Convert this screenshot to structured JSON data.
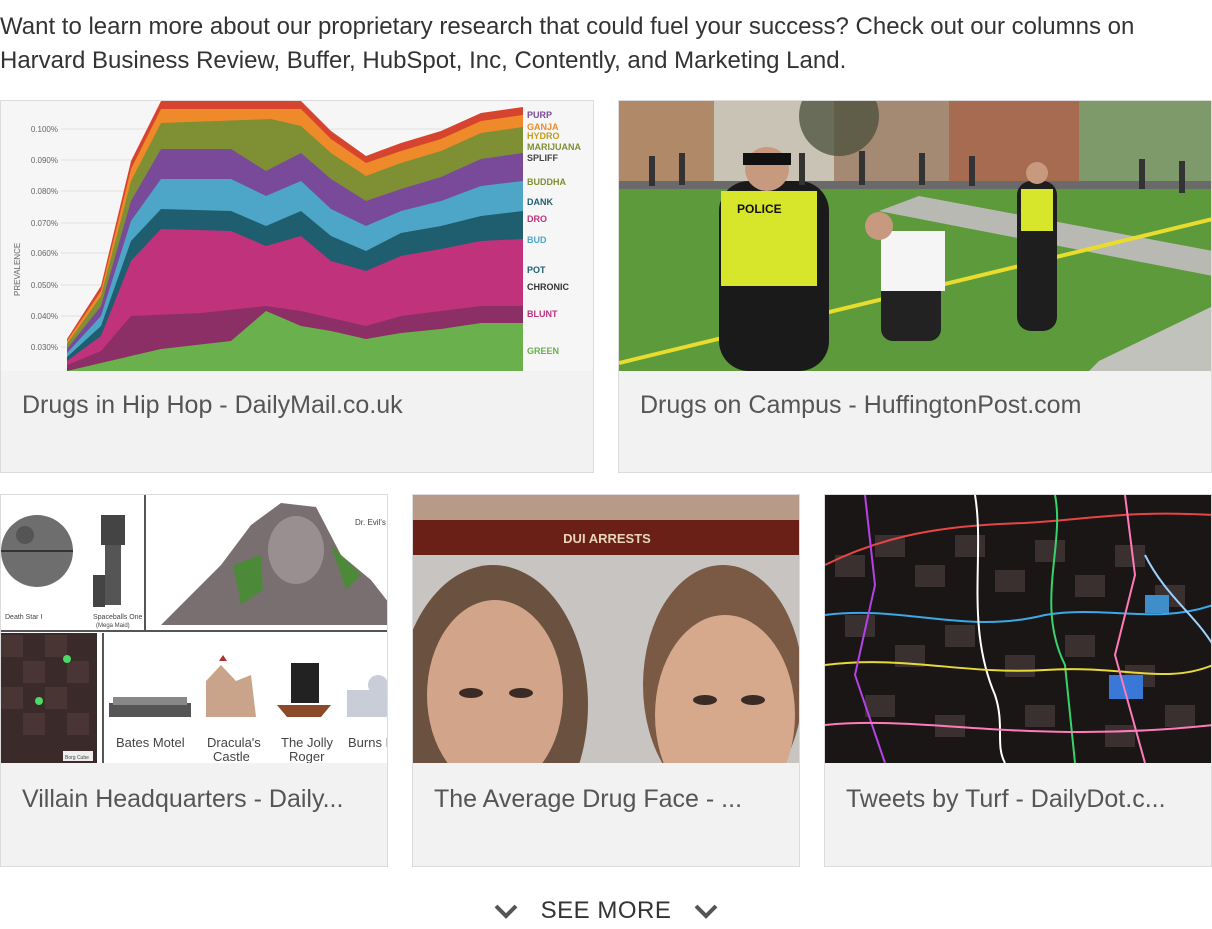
{
  "intro_text": "Want to learn more about our proprietary research that could fuel your success? Check out our columns on Harvard Business Review, Buffer, HubSpot, Inc, Contently, and Marketing Land.",
  "cards": [
    {
      "title": "Drugs in Hip Hop - DailyMail.co.uk",
      "chart": {
        "y_ticks": [
          "0.100%",
          "0.090%",
          "0.080%",
          "0.070%",
          "0.060%",
          "0.050%",
          "0.040%",
          "0.030%"
        ],
        "y_label": "PREVALENCE",
        "legend": [
          "PURP",
          "GANJA",
          "HYDRO",
          "MARIJUANA",
          "SPLIFF",
          "BUDDHA",
          "DANK",
          "DRO",
          "BUD",
          "POT",
          "CHRONIC",
          "BLUNT",
          "GREEN"
        ]
      }
    },
    {
      "title": "Drugs on Campus - HuffingtonPost.com",
      "photo_text": "POLICE"
    },
    {
      "title": "Villain Headquarters - Daily...",
      "labels": {
        "death_star": "Death Star I",
        "spaceballs": "Spaceballs One",
        "spaceballs_sub": "(Mega Maid)",
        "dr_evil": "Dr. Evil's",
        "bates": "Bates Motel",
        "dracula_1": "Dracula's",
        "dracula_2": "Castle",
        "jolly_1": "The Jolly",
        "jolly_2": "Roger",
        "burns": "Burns M",
        "borg": "Borg Cube"
      }
    },
    {
      "title": "The Average Drug Face - ...",
      "banner": "DUI ARRESTS"
    },
    {
      "title": "Tweets by Turf - DailyDot.c..."
    }
  ],
  "see_more": "SEE MORE",
  "icons": {
    "see_more_left": "chevron-down-icon",
    "see_more_right": "chevron-down-icon"
  }
}
